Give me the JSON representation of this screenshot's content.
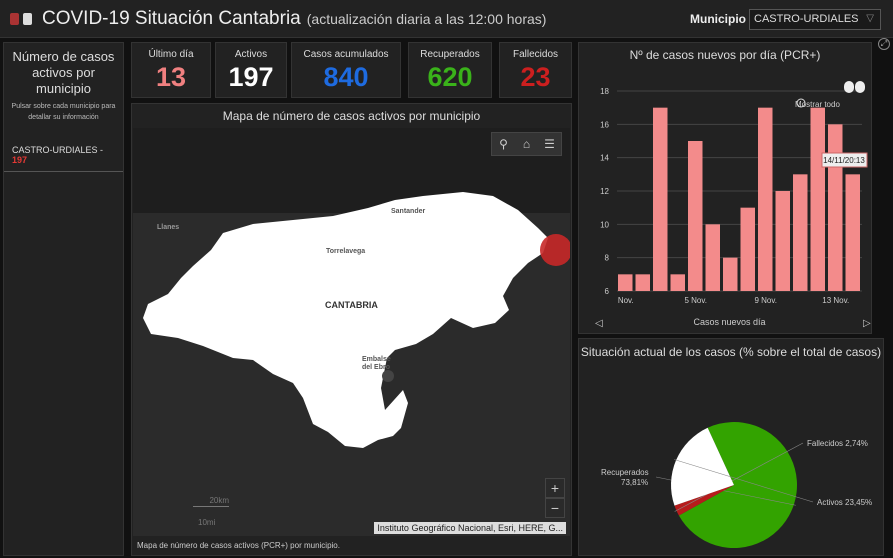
{
  "header": {
    "title": "COVID-19 Situación Cantabria",
    "subtitle": "(actualización diaria a las 12:00 horas)",
    "municipio_label": "Municipio",
    "municipio_value": "CASTRO-URDIALES"
  },
  "left": {
    "title": "Número de casos activos por municipio",
    "note": "Pulsar sobre cada municipio para detallar su información",
    "item_name": "CASTRO-URDIALES - ",
    "item_value": "197"
  },
  "kpis": [
    {
      "label": "Último día",
      "value": "13",
      "color": "#f08080"
    },
    {
      "label": "Activos",
      "value": "197",
      "color": "#ffffff"
    },
    {
      "label": "Casos acumulados",
      "value": "840",
      "color": "#1e6be0"
    },
    {
      "label": "Recuperados",
      "value": "620",
      "color": "#3ab21a"
    },
    {
      "label": "Fallecidos",
      "value": "23",
      "color": "#cc1f1f"
    }
  ],
  "map": {
    "title": "Mapa de número de casos activos por municipio",
    "labels": {
      "llanes": "Llanes",
      "santander": "Santander",
      "torrelavega": "Torrelavega",
      "cantabria": "CANTABRIA",
      "embalse": "Embalse del Ebro"
    },
    "scale_km": "20km",
    "scale_mi": "10mi",
    "zoom_in": "+",
    "zoom_out": "−",
    "attribution": "Instituto Geográfico Nacional, Esri, HERE, G...",
    "caption": "Mapa de número de casos activos (PCR+) por municipio."
  },
  "chart_data": {
    "type": "bar",
    "title": "Nº de casos nuevos por día (PCR+)",
    "xlabel": "Casos nuevos día",
    "show_all": "Mostrar todo",
    "tooltip": "14/11/20:13",
    "x_tick_labels": [
      "Nov.",
      "5 Nov.",
      "9 Nov.",
      "13 Nov."
    ],
    "values": [
      7,
      7,
      17,
      7,
      15,
      10,
      8,
      11,
      17,
      12,
      13,
      17,
      16,
      13
    ],
    "ylim": [
      6,
      18
    ],
    "yticks": [
      6,
      8,
      10,
      12,
      14,
      16,
      18
    ],
    "color": "#f38b8b"
  },
  "pie": {
    "title": "Situación actual de los casos (% sobre el total de casos)",
    "slices": [
      {
        "name": "Recuperados",
        "label": "Recuperados 73,81%",
        "value": 73.81,
        "color": "#33a300"
      },
      {
        "name": "Fallecidos",
        "label": "Fallecidos 2,74%",
        "value": 2.74,
        "color": "#b71c1c"
      },
      {
        "name": "Activos",
        "label": "Activos 23,45%",
        "value": 23.45,
        "color": "#ffffff"
      }
    ]
  }
}
